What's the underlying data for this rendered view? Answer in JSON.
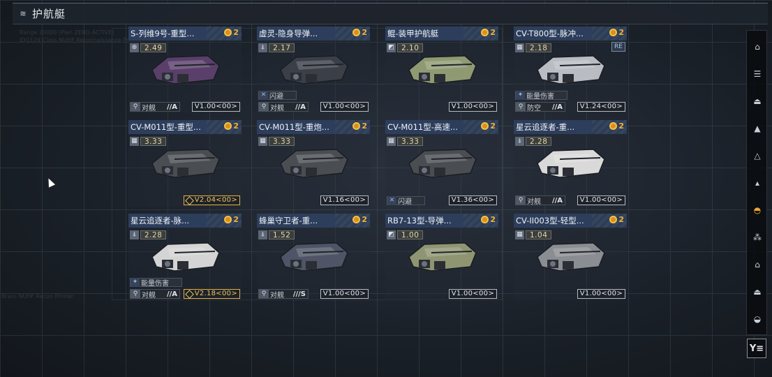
{
  "header": {
    "title": "护航艇",
    "icon": "layers-icon"
  },
  "background_text": [
    "Range 20000 (Plan ZERO ACTIVE)",
    "IDQ129 Class NUHF Reconnaissance Printer",
    "Brass NUHF Recon Printer"
  ],
  "cards": [
    {
      "name": "S-列维9号-重型...",
      "rank": "2",
      "cost": "2.49",
      "cost_icon": "fleet-icon",
      "ship_color": "#5a3f6a",
      "tags": [],
      "role": {
        "label": "对舰",
        "grade": "//A"
      },
      "version": "V1.00<00>",
      "version_gold": false,
      "re": ""
    },
    {
      "name": "虚灵-隐身导弹...",
      "rank": "2",
      "cost": "2.17",
      "cost_icon": "missile-icon",
      "ship_color": "#3a3f48",
      "tags": [
        {
          "icon": "evade-icon",
          "label": "闪避"
        }
      ],
      "role": {
        "label": "对舰",
        "grade": "//A"
      },
      "version": "V1.00<00>",
      "version_gold": false,
      "re": ""
    },
    {
      "name": "鲲-装甲护航艇",
      "rank": "2",
      "cost": "2.10",
      "cost_icon": "armor-icon",
      "ship_color": "#8f9a72",
      "tags": [],
      "role": null,
      "version": "V1.00<00>",
      "version_gold": false,
      "re": ""
    },
    {
      "name": "CV-T800型-脉冲...",
      "rank": "2",
      "cost": "2.18",
      "cost_icon": "grid-icon",
      "ship_color": "#b9bcc2",
      "tags": [
        {
          "icon": "energy-icon",
          "label": "能量伤害"
        }
      ],
      "role": {
        "label": "防空",
        "grade": "//A"
      },
      "version": "V1.24<00>",
      "version_gold": false,
      "re": "RE"
    },
    {
      "name": "CV-M011型-重型...",
      "rank": "2",
      "cost": "3.33",
      "cost_icon": "grid-icon",
      "ship_color": "#4a4d52",
      "tags": [],
      "role": null,
      "version": "V2.04<00>",
      "version_gold": true,
      "re": ""
    },
    {
      "name": "CV-M011型-重炮...",
      "rank": "2",
      "cost": "3.33",
      "cost_icon": "grid-icon",
      "ship_color": "#4a4d52",
      "tags": [],
      "role": null,
      "version": "V1.16<00>",
      "version_gold": false,
      "re": ""
    },
    {
      "name": "CV-M011型-高速...",
      "rank": "2",
      "cost": "3.33",
      "cost_icon": "grid-icon",
      "ship_color": "#4a4d52",
      "tags": [
        {
          "icon": "evade-icon",
          "label": "闪避"
        }
      ],
      "role": null,
      "version": "V1.36<00>",
      "version_gold": false,
      "re": ""
    },
    {
      "name": "星云追逐者-重...",
      "rank": "2",
      "cost": "2.28",
      "cost_icon": "missile-icon",
      "ship_color": "#d9d9d9",
      "tags": [],
      "role": {
        "label": "对舰",
        "grade": "//A"
      },
      "version": "V1.00<00>",
      "version_gold": false,
      "re": ""
    },
    {
      "name": "星云追逐者-脉...",
      "rank": "2",
      "cost": "2.28",
      "cost_icon": "missile-icon",
      "ship_color": "#d4d4d4",
      "tags": [
        {
          "icon": "energy-icon",
          "label": "能量伤害"
        }
      ],
      "role": {
        "label": "对舰",
        "grade": "//A"
      },
      "version": "V2.18<00>",
      "version_gold": true,
      "re": ""
    },
    {
      "name": "蜂巢守卫者-重...",
      "rank": "2",
      "cost": "1.52",
      "cost_icon": "missile-icon",
      "ship_color": "#4f5566",
      "tags": [],
      "role": {
        "label": "对舰",
        "grade": "///S"
      },
      "version": "V1.00<00>",
      "version_gold": false,
      "re": ""
    },
    {
      "name": "RB7-13型-导弹...",
      "rank": "2",
      "cost": "1.00",
      "cost_icon": "armor-icon",
      "ship_color": "#8f9572",
      "tags": [],
      "role": null,
      "version": "V1.00<00>",
      "version_gold": false,
      "re": ""
    },
    {
      "name": "CV-II003型-轻型...",
      "rank": "2",
      "cost": "1.04",
      "cost_icon": "grid-icon",
      "ship_color": "#8a8d92",
      "tags": [],
      "role": null,
      "version": "V1.00<00>",
      "version_gold": false,
      "re": ""
    }
  ],
  "rail": [
    {
      "icon": "flagship-icon",
      "glyph": "⌂",
      "active": false
    },
    {
      "icon": "carrier-icon",
      "glyph": "☰",
      "active": false
    },
    {
      "icon": "battlecruiser-icon",
      "glyph": "⏏",
      "active": false
    },
    {
      "icon": "cruiser-icon",
      "glyph": "▲",
      "active": false
    },
    {
      "icon": "destroyer-icon",
      "glyph": "△",
      "active": false
    },
    {
      "icon": "frigate-icon",
      "glyph": "▴",
      "active": false
    },
    {
      "icon": "corvette-icon",
      "glyph": "◓",
      "active": true
    },
    {
      "icon": "fighter-icon",
      "glyph": "⁂",
      "active": false
    },
    {
      "icon": "station-icon",
      "glyph": "⌂",
      "active": false
    },
    {
      "icon": "aircraft-icon",
      "glyph": "⏏",
      "active": false
    },
    {
      "icon": "misc-icon",
      "glyph": "◒",
      "active": false
    }
  ],
  "filter": {
    "icon": "filter-icon",
    "glyph": "Y≡"
  }
}
